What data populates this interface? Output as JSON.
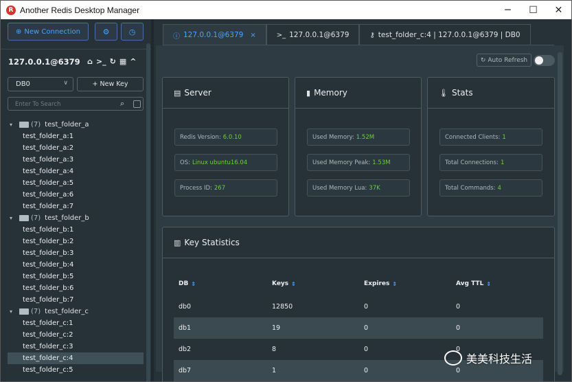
{
  "window": {
    "title": "Another Redis Desktop Manager",
    "minimize": "─",
    "maximize": "☐",
    "close": "✕"
  },
  "sidebar": {
    "new_connection": "New Connection",
    "connection_name": "127.0.0.1@6379",
    "db_select": "DB0",
    "new_key": "+ New Key",
    "search_placeholder": "Enter To Search",
    "folders": [
      {
        "count": "(7)",
        "name": "test_folder_a",
        "keys": [
          "test_folder_a:1",
          "test_folder_a:2",
          "test_folder_a:3",
          "test_folder_a:4",
          "test_folder_a:5",
          "test_folder_a:6",
          "test_folder_a:7"
        ]
      },
      {
        "count": "(7)",
        "name": "test_folder_b",
        "keys": [
          "test_folder_b:1",
          "test_folder_b:2",
          "test_folder_b:3",
          "test_folder_b:4",
          "test_folder_b:5",
          "test_folder_b:6",
          "test_folder_b:7"
        ]
      },
      {
        "count": "(7)",
        "name": "test_folder_c",
        "keys": [
          "test_folder_c:1",
          "test_folder_c:2",
          "test_folder_c:3",
          "test_folder_c:4",
          "test_folder_c:5"
        ]
      }
    ],
    "selected_key": "test_folder_c:4"
  },
  "tabs": [
    {
      "icon": "info-icon",
      "label": "127.0.0.1@6379",
      "active": true
    },
    {
      "icon": "terminal-icon",
      "label": "127.0.0.1@6379",
      "active": false
    },
    {
      "icon": "key-icon",
      "label": "test_folder_c:4 | 127.0.0.1@6379 | DB0",
      "active": false
    }
  ],
  "status": {
    "auto_refresh": "Auto Refresh",
    "server": {
      "title": "Server",
      "items": [
        {
          "label": "Redis Version:",
          "value": "6.0.10"
        },
        {
          "label": "OS:",
          "value": "Linux ubuntu16.04"
        },
        {
          "label": "Process ID:",
          "value": "267"
        }
      ]
    },
    "memory": {
      "title": "Memory",
      "items": [
        {
          "label": "Used Memory:",
          "value": "1.52M"
        },
        {
          "label": "Used Memory Peak:",
          "value": "1.53M"
        },
        {
          "label": "Used Memory Lua:",
          "value": "37K"
        }
      ]
    },
    "stats": {
      "title": "Stats",
      "items": [
        {
          "label": "Connected Clients:",
          "value": "1"
        },
        {
          "label": "Total Connections:",
          "value": "1"
        },
        {
          "label": "Total Commands:",
          "value": "4"
        }
      ]
    },
    "key_statistics": {
      "title": "Key Statistics",
      "columns": [
        "DB",
        "Keys",
        "Expires",
        "Avg TTL"
      ],
      "rows": [
        [
          "db0",
          "12850",
          "0",
          "0"
        ],
        [
          "db1",
          "19",
          "0",
          "0"
        ],
        [
          "db2",
          "8",
          "0",
          "0"
        ],
        [
          "db7",
          "1",
          "0",
          "0"
        ]
      ]
    }
  },
  "watermark": "美美科技生活",
  "colors": {
    "accent": "#4aa3ff",
    "value_green": "#6ad334",
    "background": "#263238"
  }
}
